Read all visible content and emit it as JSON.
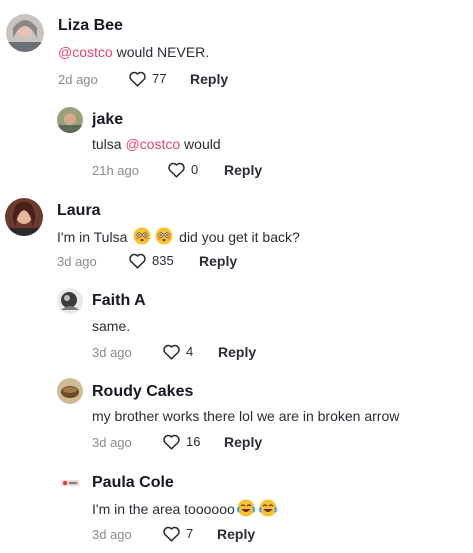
{
  "comments": [
    {
      "name": "Liza Bee",
      "mention": "@costco",
      "text_after": " would NEVER.",
      "age": "2d ago",
      "likes": "77",
      "reply": "Reply"
    },
    {
      "name": "jake",
      "text_before": "tulsa ",
      "mention": "@costco",
      "text_after": " would",
      "age": "21h ago",
      "likes": "0",
      "reply": "Reply"
    },
    {
      "name": "Laura",
      "text_before": "I'm in Tulsa ",
      "text_after": " did you get it back?",
      "age": "3d ago",
      "likes": "835",
      "reply": "Reply"
    },
    {
      "name": "Faith A",
      "text": "same.",
      "age": "3d ago",
      "likes": "4",
      "reply": "Reply"
    },
    {
      "name": "Roudy Cakes",
      "text": "my brother works there lol we are in broken arrow",
      "age": "3d ago",
      "likes": "16",
      "reply": "Reply"
    },
    {
      "name": "Paula Cole",
      "text": "I'm in the area toooooo",
      "age": "3d ago",
      "likes": "7",
      "reply": "Reply"
    }
  ],
  "icons": {
    "like": "heart-outline-icon",
    "emoji_flushed": "flushed-face-emoji",
    "emoji_laugh": "laughing-crying-emoji"
  },
  "colors": {
    "mention": "#e8456f",
    "meta": "#8a8b91",
    "text": "#161823"
  }
}
